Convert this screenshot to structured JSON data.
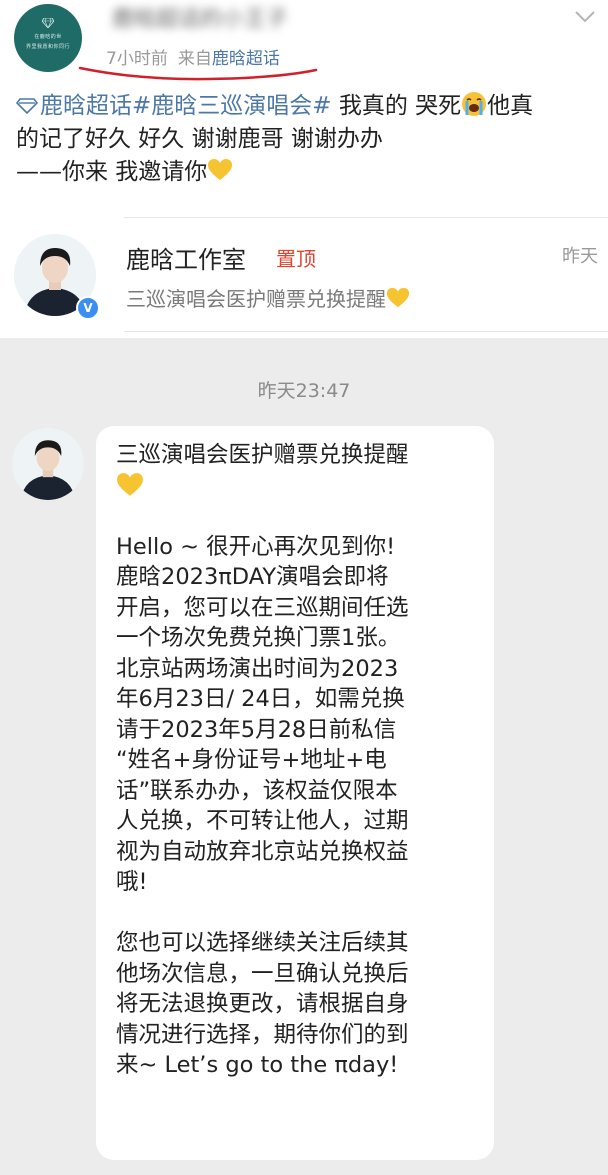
{
  "post": {
    "username": "鹿晗超话的小王子",
    "avatar_logo_line1": "在鹿晗的世",
    "avatar_logo_line2": "界里我愿和你同行",
    "time": "7小时前",
    "from_prefix": "来自",
    "source": "鹿晗超话",
    "topic1": "鹿晗超话",
    "topic2": "#鹿晗三巡演唱会#",
    "line1_text_a": " 我真的 哭死",
    "line1_text_b": "他真",
    "line2": "的记了好久 好久 谢谢鹿哥 谢谢办办",
    "line3_text": "——你来 我邀请你",
    "emoji_cry": "loudly-crying-face",
    "emoji_heart": "yellow-heart"
  },
  "repost_card": {
    "name": "鹿晗工作室",
    "pin_label": "置顶",
    "time": "昨天",
    "preview": "三巡演唱会医护赠票兑换提醒",
    "verified_badge": "V"
  },
  "chat": {
    "timestamp": "昨天23:47",
    "message_lines": [
      "三巡演唱会医护赠票兑换提醒",
      "",
      "",
      "Hello ~ 很开心再次见到你!",
      "鹿晗2023πDAY演唱会即将",
      "开启，您可以在三巡期间任选",
      "一个场次免费兑换门票1张。",
      "北京站两场演出时间为2023",
      "年6月23日/ 24日，如需兑换",
      "请于2023年5月28日前私信",
      "“姓名+身份证号+地址+电",
      "话”联系办办，该权益仅限本",
      "人兑换，不可转让他人，过期",
      "视为自动放弃北京站兑换权益",
      "哦!",
      "",
      "您也可以选择继续关注后续其",
      "他场次信息，一旦确认兑换后",
      "将无法退换更改，请根据自身",
      "情况进行选择，期待你们的到",
      "来~ Let’s go to the πday!"
    ]
  },
  "colors": {
    "link_blue": "#4c78a8",
    "pin_red": "#e0442e",
    "chat_bg": "#ececec",
    "verify_blue": "#3a8ff0",
    "avatar_teal": "#1f6b68",
    "underline_red": "#d0202a"
  }
}
